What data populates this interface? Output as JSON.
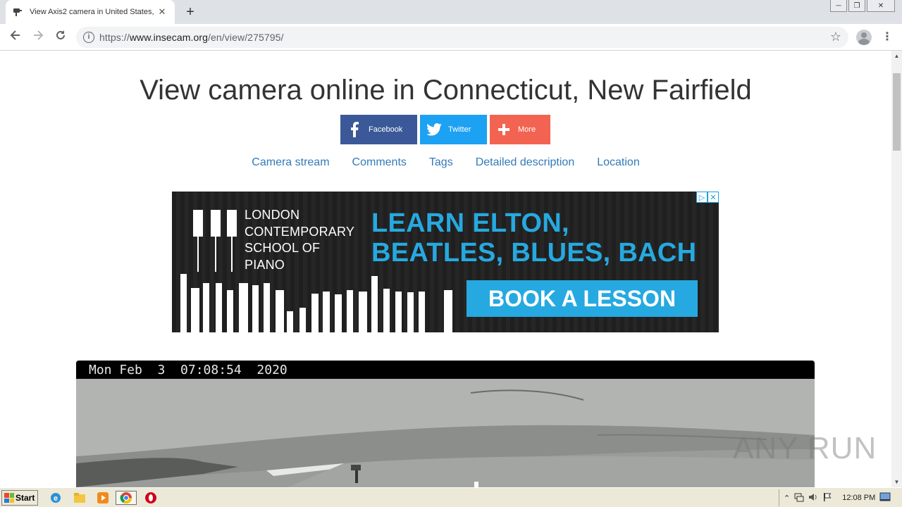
{
  "browser": {
    "tab_title": "View Axis2 camera in United States, ",
    "tab_close": "✕",
    "new_tab": "+",
    "url_scheme": "https://",
    "url_host": "www.insecam.org",
    "url_path": "/en/view/275795/",
    "window_controls": [
      "─",
      "❐",
      "✕"
    ]
  },
  "page": {
    "title": "View camera online in Connecticut, New Fairfield",
    "share": {
      "facebook": "Facebook",
      "twitter": "Twitter",
      "more": "More"
    },
    "anchors": [
      "Camera stream",
      "Comments",
      "Tags",
      "Detailed description",
      "Location"
    ]
  },
  "ad": {
    "brand_lines": [
      "LONDON",
      "CONTEMPORARY",
      "SCHOOL OF",
      "PIANO"
    ],
    "headline_lines": [
      "LEARN ELTON,",
      "BEATLES, BLUES, BACH"
    ],
    "cta": "BOOK A LESSON",
    "choices_icon": "ad-choices-icon",
    "close_icon": "ad-close-icon",
    "colors": {
      "accent": "#26a9e0",
      "background": "#222222"
    }
  },
  "camera": {
    "timestamp": "Mon Feb  3  07:08:54  2020"
  },
  "watermark": "ANY RUN",
  "taskbar": {
    "start": "Start",
    "clock": "12:08 PM",
    "apps": [
      "internet-explorer-icon",
      "explorer-icon",
      "media-player-icon",
      "chrome-icon",
      "opera-icon"
    ]
  }
}
